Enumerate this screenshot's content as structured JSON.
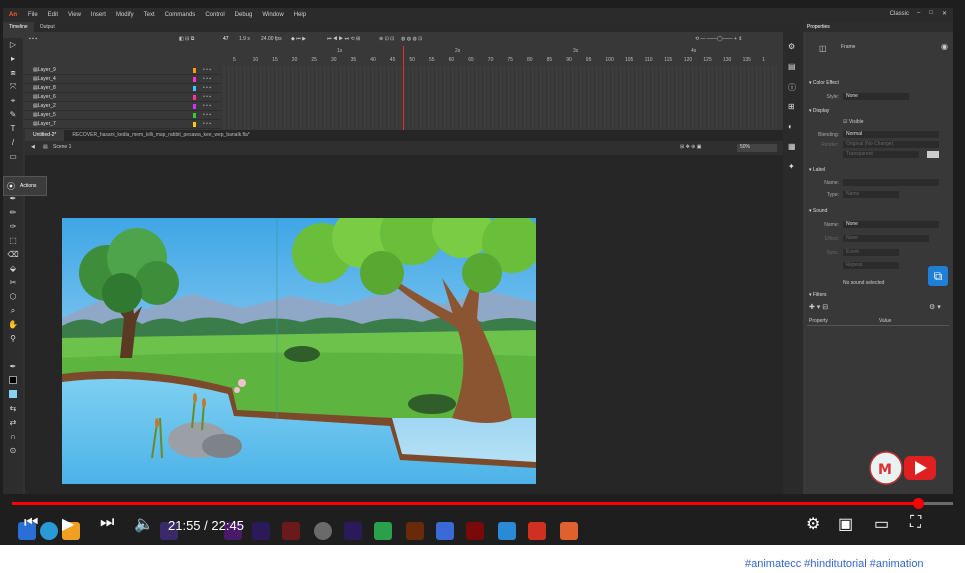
{
  "app": {
    "logo": "An",
    "menu": [
      "File",
      "Edit",
      "View",
      "Insert",
      "Modify",
      "Text",
      "Commands",
      "Control",
      "Debug",
      "Window",
      "Help"
    ],
    "workspace": "Classic",
    "window_buttons": [
      "–",
      "□",
      "✕"
    ]
  },
  "timeline": {
    "tabs": [
      "Timeline",
      "Output"
    ],
    "current_frame": "47",
    "time": "1.9 s",
    "fps": "24.00 fps",
    "ruler_seconds": [
      "1s",
      "2s",
      "3s",
      "4s"
    ],
    "ruler_frames": [
      "5",
      "10",
      "15",
      "20",
      "25",
      "30",
      "35",
      "40",
      "45",
      "50",
      "55",
      "60",
      "65",
      "70",
      "75",
      "80",
      "85",
      "90",
      "95",
      "100",
      "105",
      "110",
      "115",
      "120",
      "125",
      "130",
      "135",
      "1"
    ],
    "layers": [
      {
        "name": "Layer_9",
        "color": "#ff9900"
      },
      {
        "name": "Layer_4",
        "color": "#ff33cc"
      },
      {
        "name": "Layer_8",
        "color": "#33ccff"
      },
      {
        "name": "Layer_6",
        "color": "#ff3399"
      },
      {
        "name": "Layer_2",
        "color": "#cc33ff"
      },
      {
        "name": "Layer_5",
        "color": "#33cc33"
      },
      {
        "name": "Layer_7",
        "color": "#ffcc00"
      }
    ]
  },
  "documents": {
    "tabs": [
      "Untitled-2*",
      "RECOVER_hasani_kedia_mem_killi_map_rabbit_pesawa_kee_wep_banalk.fla*"
    ],
    "scene": "Scene 1",
    "zoom": "50%"
  },
  "actions_panel": {
    "label": "Actions"
  },
  "properties": {
    "title": "Properties",
    "frame_label": "Frame",
    "color_effect": {
      "header": "Color Effect",
      "style_label": "Style:",
      "style_value": "None"
    },
    "display": {
      "header": "Display",
      "visible_label": "Visible",
      "blending_label": "Blending:",
      "blending_value": "Normal",
      "render_label": "Render:",
      "render_value": "Original (No Change)",
      "transparent_value": "Transparent"
    },
    "label": {
      "header": "Label",
      "name_label": "Name:",
      "type_label": "Type:",
      "type_value": "Name"
    },
    "sound": {
      "header": "Sound",
      "name_label": "Name:",
      "name_value": "None",
      "effect_label": "Effect:",
      "effect_value": "None",
      "sync_label": "Sync:",
      "sync_value": "Event",
      "repeat_value": "Repeat",
      "no_sound": "No sound selected"
    },
    "filters": {
      "header": "Filters",
      "col_property": "Property",
      "col_value": "Value"
    }
  },
  "player": {
    "current_time": "21:55",
    "duration": "22:45",
    "progress": 0.963,
    "accent": "#ff0000"
  },
  "hashtags": "#animatecc #hinditutorial #animation"
}
